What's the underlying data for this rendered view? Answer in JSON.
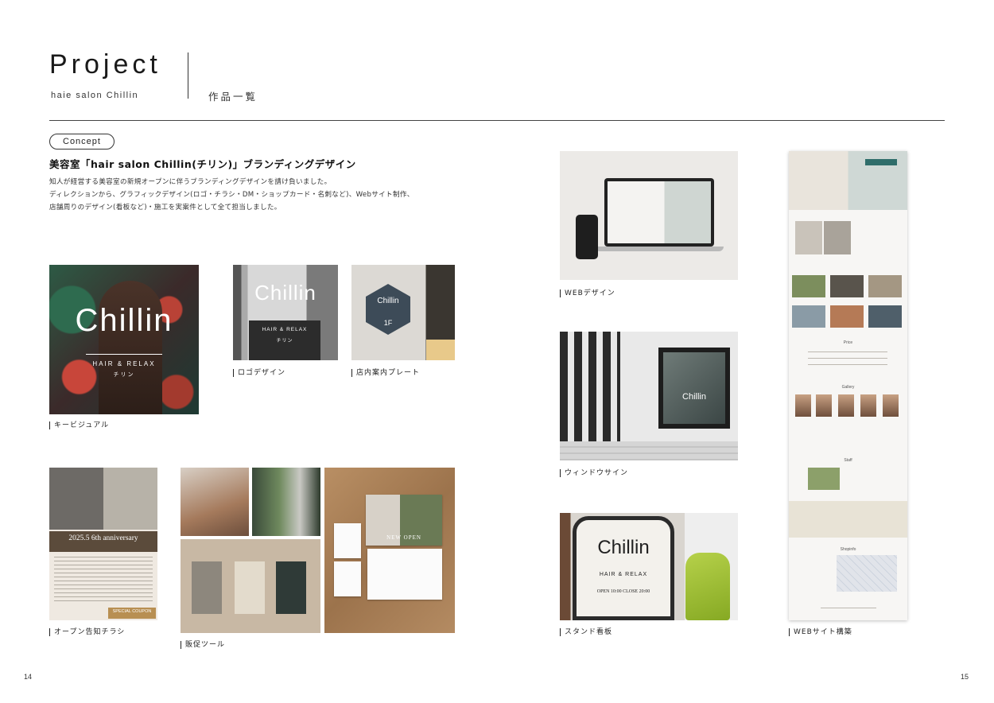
{
  "header": {
    "title": "Project",
    "subtitle": "haie salon Chillin",
    "section": "作品一覧"
  },
  "concept": {
    "badge": "Concept",
    "heading": "美容室「hair salon Chillin(チリン)」ブランディングデザイン",
    "lines": [
      "知人が経営する美容室の新規オープンに伴うブランディングデザインを請け負いました。",
      "ディレクションから、グラフィックデザイン(ロゴ・チラシ・DM・ショップカード・名刺など)、Webサイト制作、",
      "店舗周りのデザイン(看板など)・施工を実案件として全て担当しました。"
    ]
  },
  "captions": {
    "key_visual": "キービジュアル",
    "logo": "ロゴデザイン",
    "plate": "店内案内プレート",
    "flyer": "オープン告知チラシ",
    "promo": "販促ツール",
    "web_design": "WEBデザイン",
    "window": "ウィンドウサイン",
    "stand": "スタンド看板",
    "website": "WEBサイト構築"
  },
  "artwork": {
    "brand": "Chillin",
    "tagline": "HAIR & RELAX",
    "kana": "チリン",
    "floor": "1F",
    "anniversary": "2025.5 6th anniversary",
    "new_open": "NEW OPEN",
    "coupon": "SPECIAL COUPON",
    "open_hours": "OPEN 10:00  CLOSE 20:00",
    "site_sections": [
      "Price",
      "Gallery",
      "Staff",
      "Shopinfo"
    ]
  },
  "pages": {
    "left": "14",
    "right": "15"
  },
  "colors": {
    "text": "#222222",
    "rule": "#444444",
    "plate_navy": "#3d4b58",
    "chair_green": "#9bbd33"
  }
}
